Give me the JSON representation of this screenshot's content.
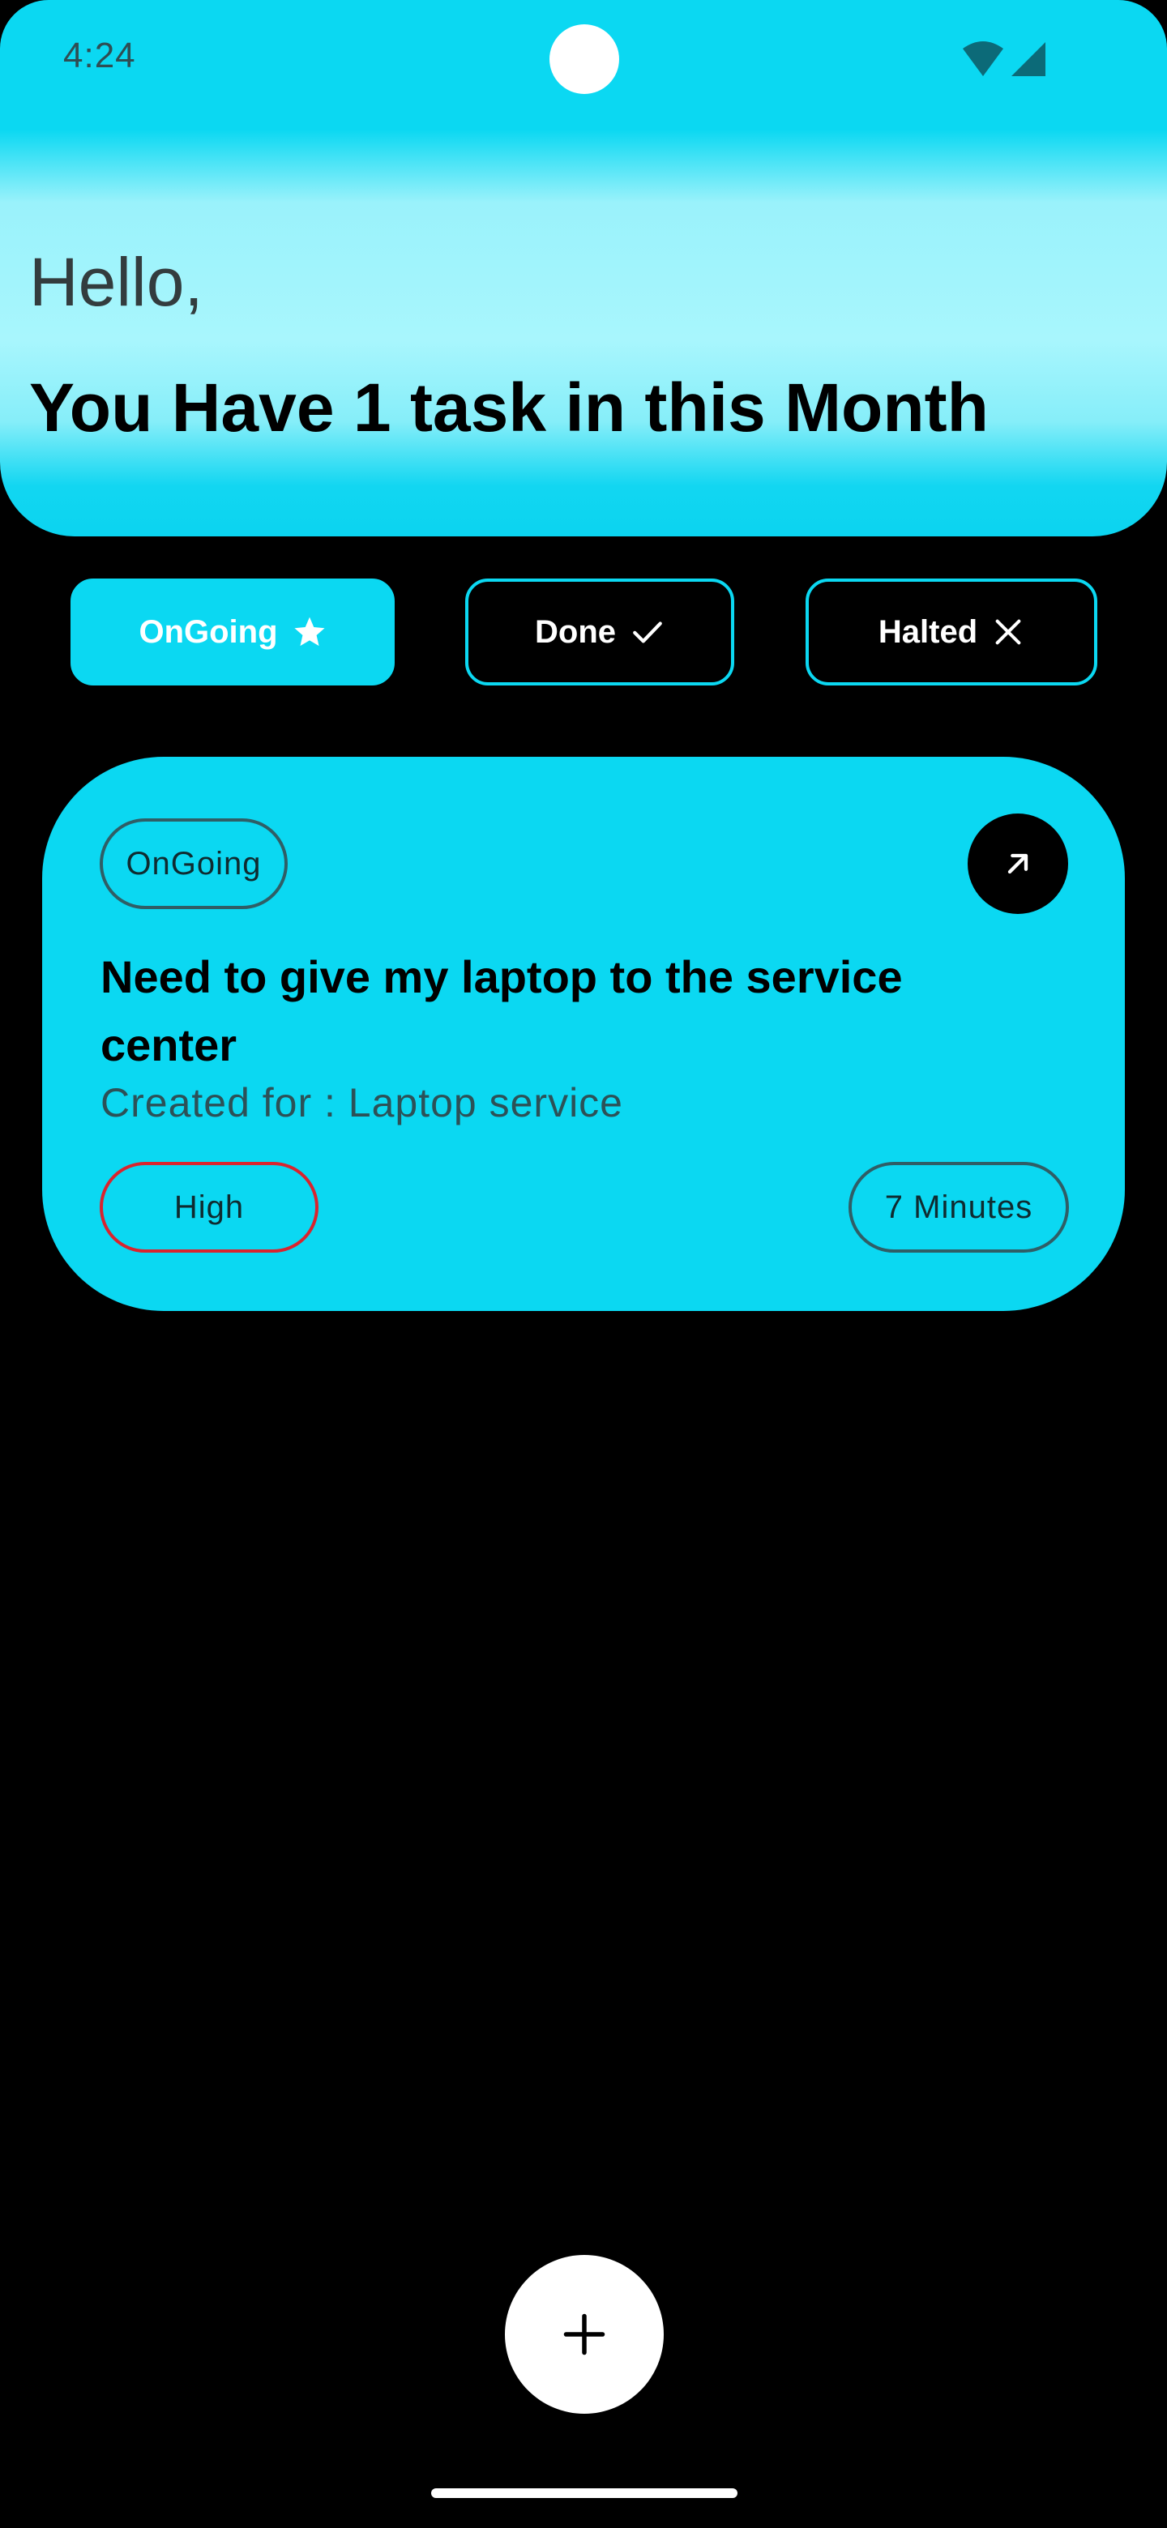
{
  "status_bar": {
    "time": "4:24",
    "icons": [
      "wifi-icon",
      "cellular-signal-icon"
    ]
  },
  "header": {
    "greeting": "Hello,",
    "headline": "You Have 1 task in this Month"
  },
  "tabs": [
    {
      "label": "OnGoing",
      "icon": "star-icon",
      "active": true
    },
    {
      "label": "Done",
      "icon": "checkmark-icon",
      "active": false
    },
    {
      "label": "Halted",
      "icon": "close-icon",
      "active": false
    }
  ],
  "task_card": {
    "status": "OnGoing",
    "title": "Need to give my laptop to the service center",
    "subtitle": "Created for : Laptop service",
    "priority": "High",
    "duration": "7 Minutes",
    "open_icon": "arrow-up-right-icon"
  },
  "fab": {
    "icon": "plus-icon"
  },
  "colors": {
    "accent": "#0bd8f2",
    "background": "#000000",
    "priority_high_border": "#d9242e",
    "pill_border": "#2f5e66"
  }
}
